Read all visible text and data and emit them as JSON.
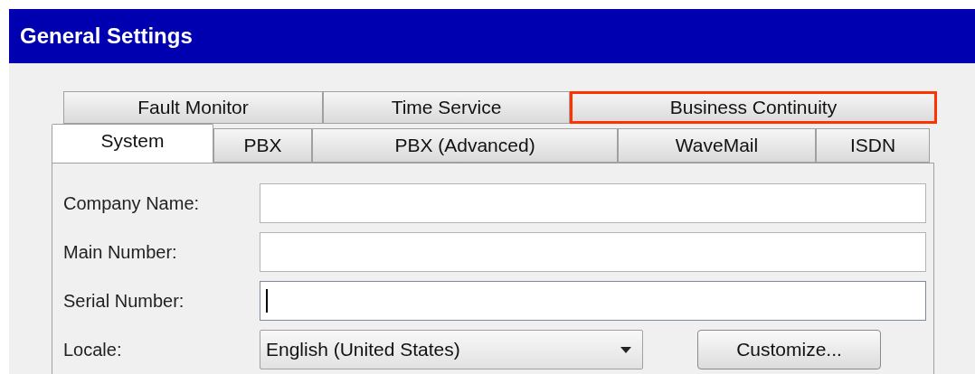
{
  "window": {
    "title": "General Settings"
  },
  "tab_rows": [
    {
      "tabs": [
        {
          "label": "Fault Monitor",
          "selected": false,
          "highlighted": false
        },
        {
          "label": "Time Service",
          "selected": false,
          "highlighted": false
        },
        {
          "label": "Business Continuity",
          "selected": false,
          "highlighted": true
        }
      ]
    },
    {
      "tabs": [
        {
          "label": "System",
          "selected": true,
          "highlighted": false
        },
        {
          "label": "PBX",
          "selected": false,
          "highlighted": false
        },
        {
          "label": "PBX (Advanced)",
          "selected": false,
          "highlighted": false
        },
        {
          "label": "WaveMail",
          "selected": false,
          "highlighted": false
        },
        {
          "label": "ISDN",
          "selected": false,
          "highlighted": false
        }
      ]
    }
  ],
  "fields": [
    {
      "label": "Company Name:",
      "focused": false
    },
    {
      "label": "Main Number:",
      "focused": false
    },
    {
      "label": "Serial Number:",
      "focused": true
    }
  ],
  "locale": {
    "label": "Locale:",
    "value": "English (United States)"
  },
  "buttons": [
    "Customize..."
  ]
}
